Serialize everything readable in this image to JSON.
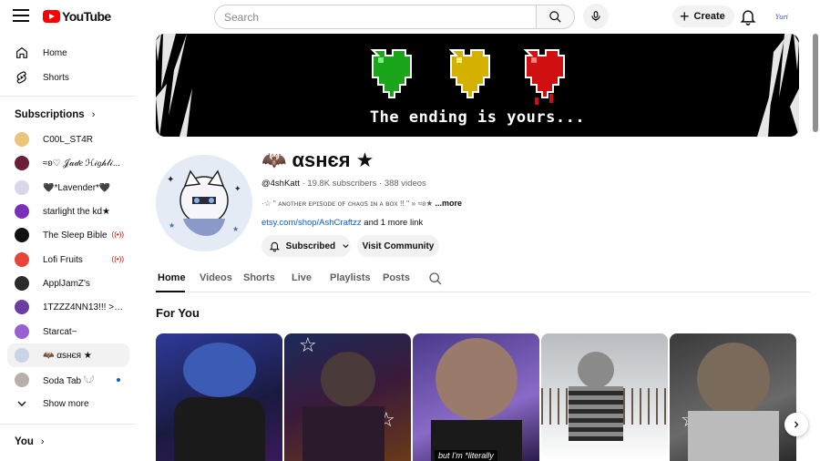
{
  "header": {
    "logo_text": "YouTube",
    "search_placeholder": "Search",
    "create_label": "Create",
    "avatar_text": "Yuri"
  },
  "sidebar": {
    "main": [
      {
        "label": "Home",
        "icon": "home-icon"
      },
      {
        "label": "Shorts",
        "icon": "shorts-icon"
      }
    ],
    "subscriptions_title": "Subscriptions",
    "subscriptions": [
      {
        "label": "C00L_ST4R",
        "avatar_color": "#e9c47a",
        "badge": ""
      },
      {
        "label": "≈ʚ♡ 𝒥𝒶𝒹𝑒 ℋ𝒾𝑔𝒽𝓁𝒾...",
        "avatar_color": "#6b1d3a",
        "badge": ""
      },
      {
        "label": "🖤*Lavender*🖤",
        "avatar_color": "#d8d8e8",
        "badge": ""
      },
      {
        "label": "starlight the kd★",
        "avatar_color": "#7a2fb8",
        "badge": ""
      },
      {
        "label": "The Sleep Bible",
        "avatar_color": "#111111",
        "badge": "live"
      },
      {
        "label": "Lofi Fruits",
        "avatar_color": "#e8443a",
        "badge": "live"
      },
      {
        "label": "ApplJamZ's",
        "avatar_color": "#2a2a2a",
        "badge": ""
      },
      {
        "label": "1TZZZ4NN13!!! >_<...",
        "avatar_color": "#6b3fa0",
        "badge": ""
      },
      {
        "label": "Starcat~",
        "avatar_color": "#9a5fd0",
        "badge": ""
      },
      {
        "label": "🦇 αsнєя ★",
        "avatar_color": "#c9d4e8",
        "badge": ""
      },
      {
        "label": "Soda Tab 𓆩𓆪",
        "avatar_color": "#b8b0a8",
        "badge": "new"
      }
    ],
    "show_more": "Show more",
    "you_title": "You"
  },
  "banner": {
    "text": "The ending is yours..."
  },
  "channel": {
    "name": "🦇 αsнєя ★",
    "handle": "@4shKatt",
    "subscribers": "19.8K subscribers",
    "videos": "388 videos",
    "description": "·☆ \" ᴀɴᴏᴛʜᴇʀ ᴇᴘɪꜱᴏᴅᴇ ᴏꜰ ᴄʜᴀᴏꜱ ɪɴ ᴀ ʙᴏx !! \" » ≈ʚ★ ",
    "more_label": "...more",
    "link": "etsy.com/shop/AshCraftzz",
    "link_suffix": " and 1 more link",
    "subscribed_label": "Subscribed",
    "visit_label": "Visit Community"
  },
  "tabs": [
    "Home",
    "Videos",
    "Shorts",
    "Live",
    "Playlists",
    "Posts"
  ],
  "section_title": "For You",
  "shorts": [
    {
      "caption": "",
      "bg": "#3a3f8a"
    },
    {
      "caption": "",
      "bg": "#4a2a4a"
    },
    {
      "caption": "but I'm *literally",
      "bg": "#6b4aa0"
    },
    {
      "caption": "",
      "bg": "#c8ccd0"
    },
    {
      "caption": "",
      "bg": "#5a5a5a"
    }
  ],
  "colors": {
    "accent": "#ff0000",
    "link": "#065fd4"
  }
}
